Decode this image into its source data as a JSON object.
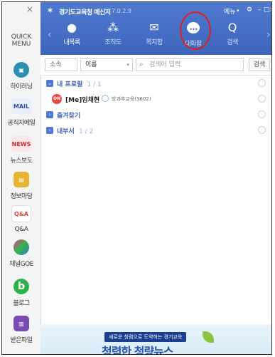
{
  "quick_menu": {
    "close": "×",
    "title": "QUICK\nMENU",
    "items": [
      {
        "label": "하이러닝",
        "icon": "hi-learning-icon"
      },
      {
        "label": "공직자메일",
        "icon_text": "MAIL"
      },
      {
        "label": "뉴스보도",
        "icon_text": "NEWS"
      },
      {
        "label": "정보마당",
        "icon": "info-folder-icon"
      },
      {
        "label": "Q&A",
        "icon_text": "Q&A"
      },
      {
        "label": "채널GOE",
        "icon": "channel-goe-icon"
      },
      {
        "label": "블로그",
        "icon_text": "b"
      },
      {
        "label": "받은파일",
        "icon": "received-file-icon"
      }
    ]
  },
  "header": {
    "app_title": "경기도교육청 메신저",
    "version": "7.0.2.9",
    "menu_label": "메뉴",
    "nav": [
      {
        "label": "내목록",
        "icon": "person-icon",
        "active": true
      },
      {
        "label": "조직도",
        "icon": "org-chart-icon"
      },
      {
        "label": "쪽지함",
        "icon": "message-icon"
      },
      {
        "label": "대화함",
        "icon": "chat-icon"
      },
      {
        "label": "검색",
        "icon": "search-icon"
      }
    ]
  },
  "search": {
    "scope": "소속",
    "field": "이름",
    "placeholder": "검색어 입력",
    "button": "검색"
  },
  "tree": {
    "my_profile": {
      "label": "내 프로필",
      "count": "1 / 1"
    },
    "me": {
      "status": "ON",
      "name": "[Me]임채현",
      "dept": "방과후교육(3602)"
    },
    "favorites": {
      "label": "즐겨찾기"
    },
    "my_dept": {
      "label": "내부서",
      "count": "1 / 2"
    }
  },
  "banner": {
    "top": "새로운 청렴으로 도약하는 경기교육",
    "main": "청렴한 청량뉴스"
  },
  "colors": {
    "header_blue": "#4066bf",
    "accent_red": "#e0201f"
  }
}
